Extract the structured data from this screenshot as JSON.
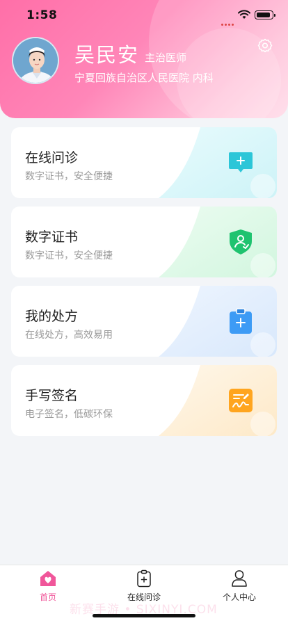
{
  "status": {
    "time": "1:58"
  },
  "profile": {
    "name": "吴民安",
    "title": "主治医师",
    "hospital": "宁夏回族自治区人民医院 内科"
  },
  "cards": [
    {
      "title": "在线问诊",
      "subtitle": "数字证书，安全便捷",
      "icon": "chat-plus-icon",
      "color": "#2cc6d8"
    },
    {
      "title": "数字证书",
      "subtitle": "数字证书，安全便捷",
      "icon": "shield-user-icon",
      "color": "#1fc36f"
    },
    {
      "title": "我的处方",
      "subtitle": "在线处方，高效易用",
      "icon": "clipboard-plus-icon",
      "color": "#3d9bf5"
    },
    {
      "title": "手写签名",
      "subtitle": "电子签名，低碳环保",
      "icon": "signature-icon",
      "color": "#ffa51f"
    }
  ],
  "tabbar": {
    "items": [
      {
        "label": "首页",
        "icon": "home-icon",
        "active": true
      },
      {
        "label": "在线问诊",
        "icon": "clipboard-plus-icon",
        "active": false
      },
      {
        "label": "个人中心",
        "icon": "person-icon",
        "active": false
      }
    ]
  },
  "watermark": "新赛手游 • SIXINYI.COM",
  "colors": {
    "accent": "#f0569a",
    "header": "#ff7fb2"
  }
}
